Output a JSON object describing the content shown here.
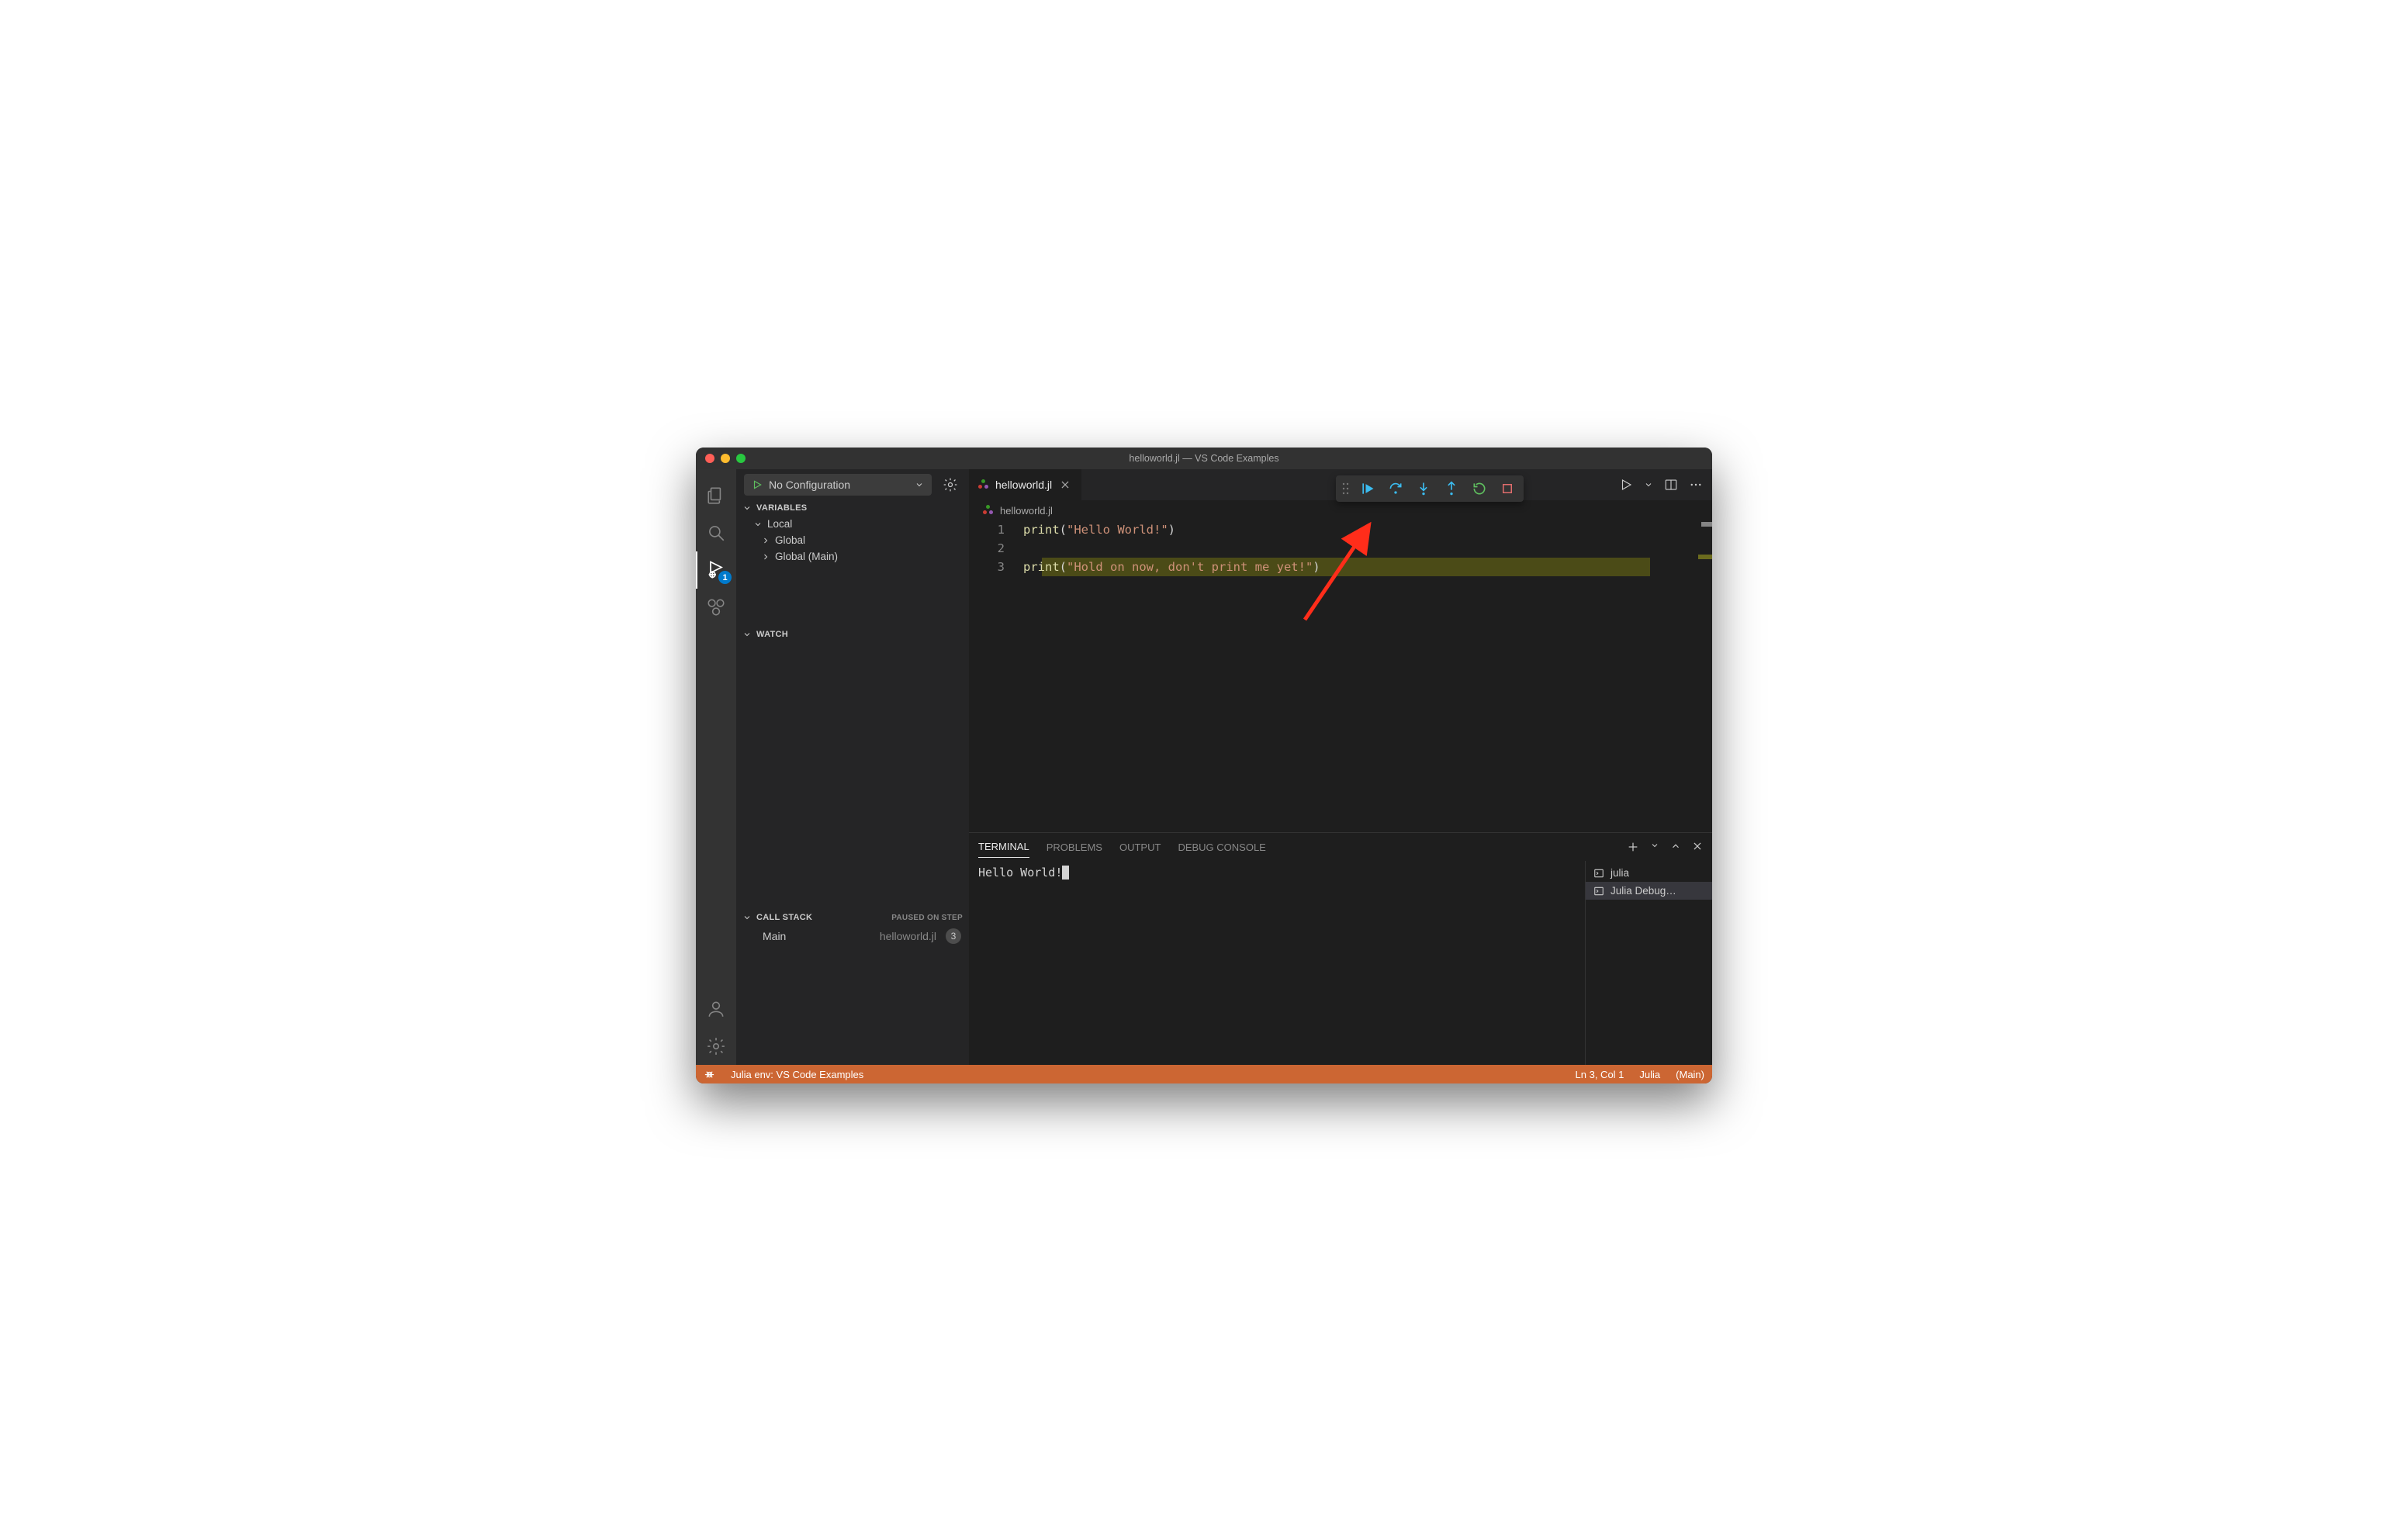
{
  "title": "helloworld.jl — VS Code Examples",
  "activitybar": {
    "badge": "1"
  },
  "sidebar": {
    "config_label": "No Configuration",
    "sections": {
      "variables": "VARIABLES",
      "watch": "WATCH",
      "callstack": "CALL STACK",
      "callstack_status": "PAUSED ON STEP"
    },
    "var_tree": {
      "local": "Local",
      "global": "Global",
      "global_main": "Global (Main)"
    },
    "callstack_item": {
      "frame": "Main",
      "file": "helloworld.jl",
      "line": "3"
    }
  },
  "tab": {
    "filename": "helloworld.jl",
    "breadcrumb": "helloworld.jl"
  },
  "code": {
    "lines": [
      "1",
      "2",
      "3"
    ],
    "l1_fn": "print",
    "l1_open": "(",
    "l1_str": "\"Hello World!\"",
    "l1_close": ")",
    "l3_fn": "print",
    "l3_open": "(",
    "l3_str": "\"Hold on now, don't print me yet!\"",
    "l3_close": ")"
  },
  "panel": {
    "tabs": {
      "terminal": "TERMINAL",
      "problems": "PROBLEMS",
      "output": "OUTPUT",
      "debug": "DEBUG CONSOLE"
    },
    "terminal_output": "Hello World!",
    "terms": {
      "julia": "julia",
      "debug": "Julia Debug…"
    }
  },
  "status": {
    "env": "Julia env: VS Code Examples",
    "pos": "Ln 3, Col 1",
    "lang": "Julia",
    "mode": "(Main)"
  }
}
